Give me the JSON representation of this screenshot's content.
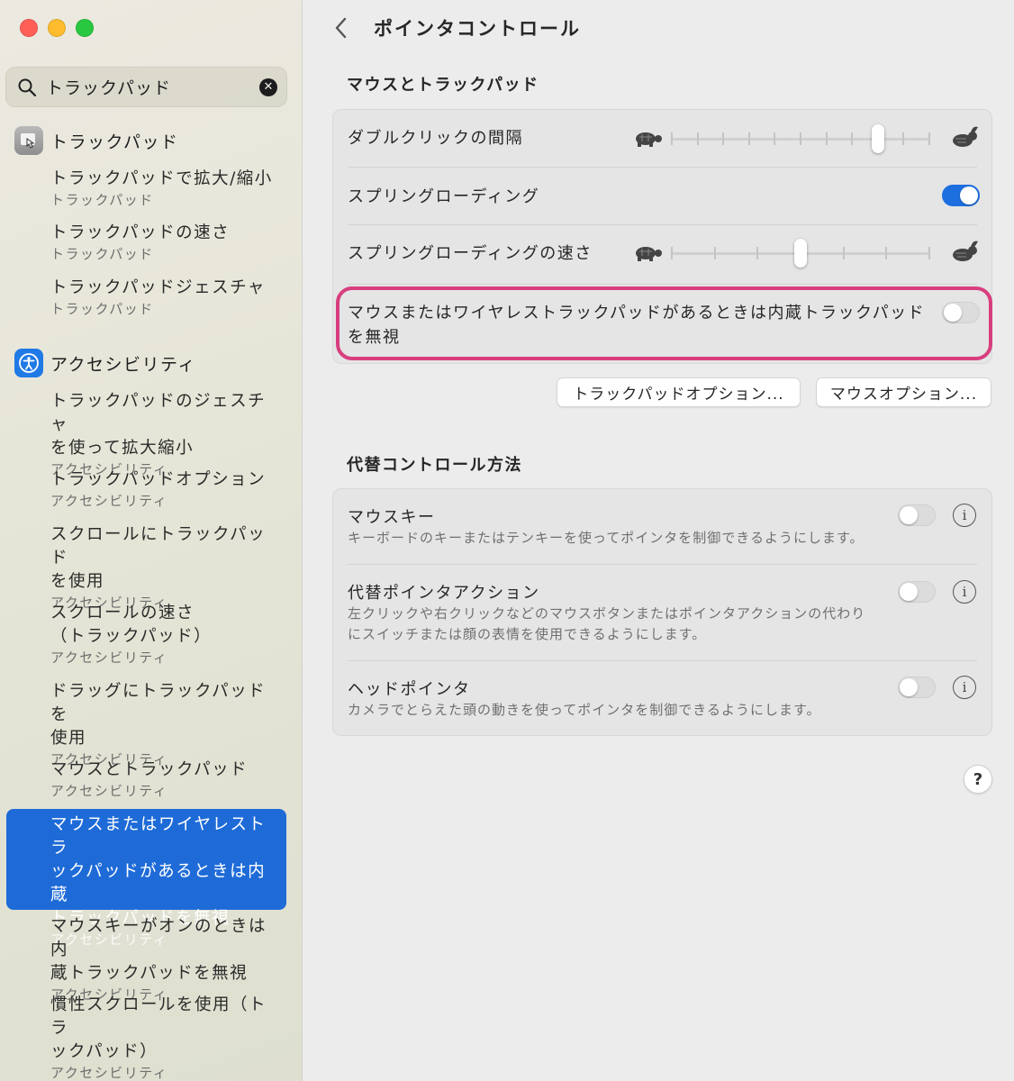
{
  "sidebar": {
    "search": {
      "value": "トラックパッド"
    },
    "sections": [
      {
        "label": "トラックパッド",
        "icon": "trackpad-icon"
      },
      {
        "label": "アクセシビリティ",
        "icon": "accessibility-icon"
      }
    ],
    "items": [
      {
        "title": "トラックパッドで拡大/縮小",
        "sub": "トラックパッド"
      },
      {
        "title": "トラックパッドの速さ",
        "sub": "トラックパッド"
      },
      {
        "title": "トラックパッドジェスチャ",
        "sub": "トラックパッド"
      },
      {
        "title_l1": "トラックパッドのジェスチャ",
        "title_l2": "を使って拡大縮小",
        "sub": "アクセシビリティ"
      },
      {
        "title": "トラックパッドオプション",
        "sub": "アクセシビリティ"
      },
      {
        "title_l1": "スクロールにトラックパッド",
        "title_l2": "を使用",
        "sub": "アクセシビリティ"
      },
      {
        "title_l1": "スクロールの速さ",
        "title_l2": "（トラックパッド）",
        "sub": "アクセシビリティ"
      },
      {
        "title_l1": "ドラッグにトラックパッドを",
        "title_l2": "使用",
        "sub": "アクセシビリティ"
      },
      {
        "title": "マウスとトラックパッド",
        "sub": "アクセシビリティ"
      },
      {
        "title_l1": "マウスまたはワイヤレストラ",
        "title_l2": "ックパッドがあるときは内蔵",
        "title_l3": "トラックパッドを無視",
        "sub": "アクセシビリティ"
      },
      {
        "title_l1": "マウスキーがオンのときは内",
        "title_l2": "蔵トラックパッドを無視",
        "sub": "アクセシビリティ"
      },
      {
        "title_l1": "慣性スクロールを使用（トラ",
        "title_l2": "ックパッド）",
        "sub": "アクセシビリティ"
      }
    ]
  },
  "header": {
    "title": "ポインタコントロール"
  },
  "mouse_trackpad": {
    "heading": "マウスとトラックパッド",
    "double_click": {
      "label": "ダブルクリックの間隔",
      "value": 0.8
    },
    "spring_loading": {
      "label": "スプリングローディング",
      "enabled": true
    },
    "spring_speed": {
      "label": "スプリングローディングの速さ",
      "value": 0.5
    },
    "ignore_builtin": {
      "label_l1": "マウスまたはワイヤレストラックパッドがあるときは内蔵トラックパッド",
      "label_l2": "を無視",
      "enabled": false
    },
    "buttons": {
      "trackpad_options": "トラックパッドオプション...",
      "mouse_options": "マウスオプション..."
    }
  },
  "alternate": {
    "heading": "代替コントロール方法",
    "mouse_keys": {
      "label": "マウスキー",
      "desc": "キーボードのキーまたはテンキーを使ってポインタを制御できるようにします。",
      "enabled": false
    },
    "alt_pointer": {
      "label": "代替ポインタアクション",
      "desc_l1": "左クリックや右クリックなどのマウスボタンまたはポインタアクションの代わり",
      "desc_l2": "にスイッチまたは顔の表情を使用できるようにします。",
      "enabled": false
    },
    "head_pointer": {
      "label": "ヘッドポインタ",
      "desc": "カメラでとらえた頭の動きを使ってポインタを制御できるようにします。",
      "enabled": false
    }
  },
  "help": {
    "label": "?"
  },
  "colors": {
    "accent": "#1d6fe0",
    "selection": "#1e6bd8",
    "highlight": "#d83e7f"
  }
}
